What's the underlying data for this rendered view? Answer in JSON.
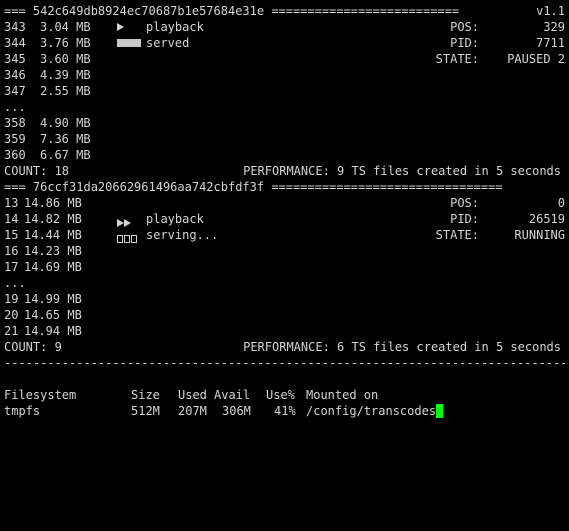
{
  "stream1": {
    "header_left": "=== 542c649db8924ec70687b1e57684e31e",
    "header_fill": " ==========================",
    "header_right": "v1.1",
    "rows": [
      {
        "idx": "343",
        "size": "3.04 MB"
      },
      {
        "idx": "344",
        "size": "3.76 MB"
      },
      {
        "idx": "345",
        "size": "3.60 MB"
      },
      {
        "idx": "346",
        "size": "4.39 MB"
      },
      {
        "idx": "347",
        "size": "2.55 MB"
      },
      {
        "idx": "358",
        "size": "4.90 MB"
      },
      {
        "idx": "359",
        "size": "7.36 MB"
      },
      {
        "idx": "360",
        "size": "6.67 MB"
      }
    ],
    "ellipsis": "...",
    "status_playback": "playback",
    "status_serving": "served",
    "pos_label": "POS:",
    "pos_value": "329",
    "pid_label": "PID:",
    "pid_value": "7711",
    "state_label": "STATE:",
    "state_value": "PAUSED 2",
    "count": "COUNT: 18",
    "performance": "PERFORMANCE: 9 TS files created in 5 seconds"
  },
  "stream2": {
    "header_left": "=== 76ccf31da20662961496aa742cbfdf3f",
    "header_fill": " ================================",
    "rows": [
      {
        "idx": "13",
        "size": "14.86 MB"
      },
      {
        "idx": "14",
        "size": "14.82 MB"
      },
      {
        "idx": "15",
        "size": "14.44 MB"
      },
      {
        "idx": "16",
        "size": "14.23 MB"
      },
      {
        "idx": "17",
        "size": "14.69 MB"
      },
      {
        "idx": "19",
        "size": "14.99 MB"
      },
      {
        "idx": "20",
        "size": "14.65 MB"
      },
      {
        "idx": "21",
        "size": "14.94 MB"
      }
    ],
    "ellipsis": "...",
    "status_playback": "playback",
    "status_serving": "serving...",
    "pos_label": "POS:",
    "pos_value": "0",
    "pid_label": "PID:",
    "pid_value": "26519",
    "state_label": "STATE:",
    "state_value": "RUNNING",
    "count": "COUNT: 9",
    "performance": "PERFORMANCE: 6 TS files created in 5 seconds"
  },
  "divider": "--------------------------------------------------------------------------------",
  "df": {
    "headers": {
      "filesystem": "Filesystem",
      "size": "Size",
      "used": "Used",
      "avail": "Avail",
      "use_pct": "Use%",
      "mounted": "Mounted on"
    },
    "row": {
      "filesystem": "tmpfs",
      "size": "512M",
      "used": "207M",
      "avail": "306M",
      "use_pct": "41%",
      "mounted": "/config/transcodes"
    }
  },
  "colors": {
    "background": "#000000",
    "text": "#d4d4d4",
    "cursor": "#00ff00"
  },
  "icons": {
    "playback_paused": "play-triangle-icon",
    "playback_running": "fast-forward-icon",
    "served": "progress-bar-full-icon",
    "serving": "progress-bar-segments-icon"
  }
}
